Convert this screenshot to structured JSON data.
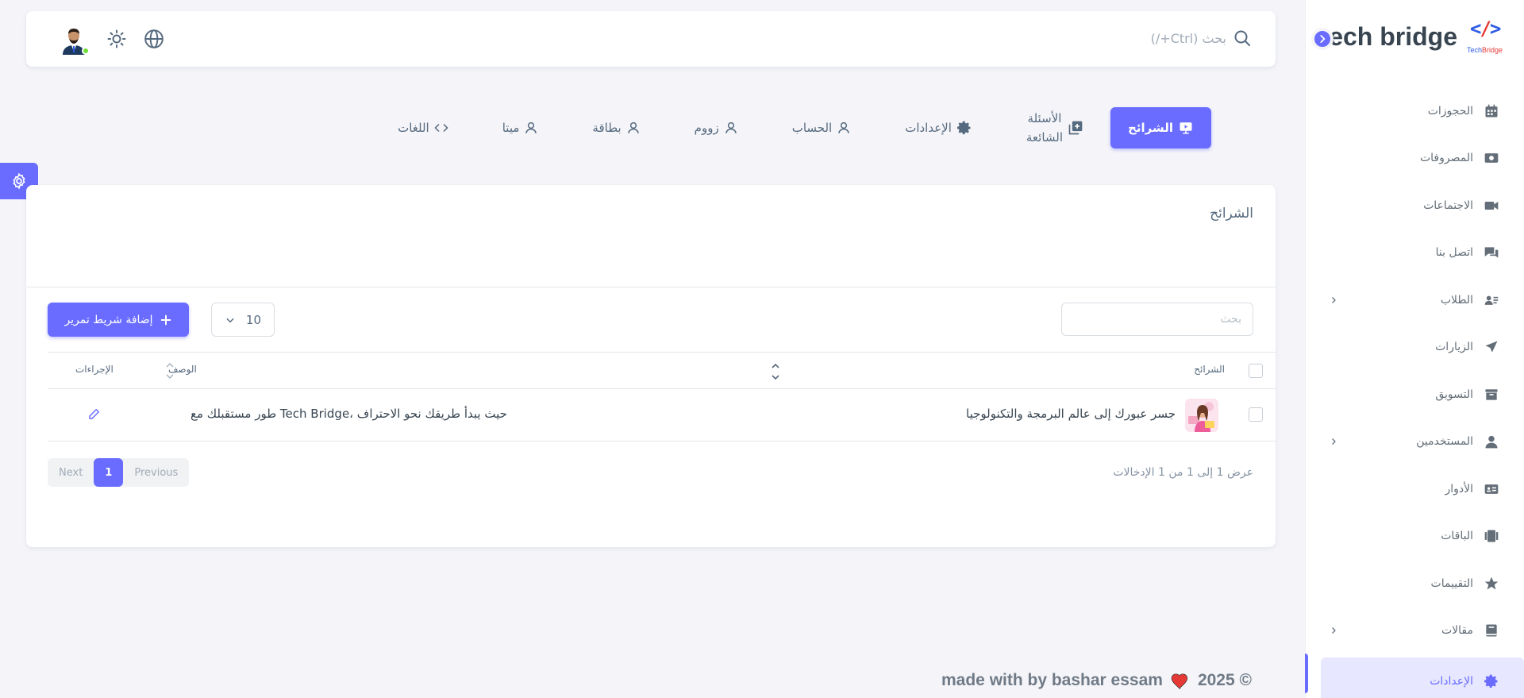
{
  "brand": {
    "name": "tech bridge",
    "logo_code": "</>",
    "logo_sub_1": "Tech",
    "logo_sub_2": "Bridge"
  },
  "colors": {
    "accent": "#696cff",
    "online": "#71dd37",
    "heart": "#e53935"
  },
  "navbar": {
    "search_placeholder": "بحث (Ctrl+/)"
  },
  "tabs": [
    {
      "label": "الشرائح",
      "icon": "slides-icon"
    },
    {
      "label": "الأسئلة",
      "label2": "الشائعة",
      "icon": "faq-icon"
    },
    {
      "label": "الإعدادات",
      "icon": "gear-icon"
    },
    {
      "label": "الحساب",
      "icon": "user-icon"
    },
    {
      "label": "زووم",
      "icon": "user-icon"
    },
    {
      "label": "بطاقة",
      "icon": "user-icon"
    },
    {
      "label": "ميتا",
      "icon": "user-icon"
    },
    {
      "label": "اللغات",
      "icon": "code-icon"
    }
  ],
  "sidebar": {
    "items": [
      {
        "label": "الحجوزات",
        "icon": "calendar-icon"
      },
      {
        "label": "المصروفات",
        "icon": "money-icon"
      },
      {
        "label": "الاجتماعات",
        "icon": "video-icon"
      },
      {
        "label": "اتصل بنا",
        "icon": "chat-icon"
      },
      {
        "label": "الطلاب",
        "icon": "students-icon",
        "chevron": true
      },
      {
        "label": "الزيارات",
        "icon": "plane-icon"
      },
      {
        "label": "التسويق",
        "icon": "archive-icon"
      },
      {
        "label": "المستخدمين",
        "icon": "user-icon",
        "chevron": true
      },
      {
        "label": "الأدوار",
        "icon": "id-card-icon"
      },
      {
        "label": "الباقات",
        "icon": "cards-icon"
      },
      {
        "label": "التقييمات",
        "icon": "star-icon"
      },
      {
        "label": "مقالات",
        "icon": "book-icon",
        "chevron": true
      },
      {
        "label": "الإعدادات",
        "icon": "gear-icon",
        "active": true
      }
    ]
  },
  "card": {
    "title": "الشرائح",
    "search_placeholder": "بحث",
    "page_size": "10",
    "add_button": "إضافة شريط تمرير",
    "columns": {
      "slides": "الشرائح",
      "description": "الوصف",
      "actions": "الإجراءات"
    },
    "rows": [
      {
        "title": "جسر عبورك إلى عالم البرمجة والتكنولوجيا",
        "description": "طور مستقبلك مع Tech Bridge، حيث يبدأ طريقك نحو الاحتراف"
      }
    ],
    "showing": "عرض 1 إلى 1 من 1 الإدخالات",
    "pager": {
      "prev": "Previous",
      "current": "1",
      "next": "Next"
    }
  },
  "footer": {
    "text": "made with by bashar essam",
    "year": "2025 ©"
  }
}
